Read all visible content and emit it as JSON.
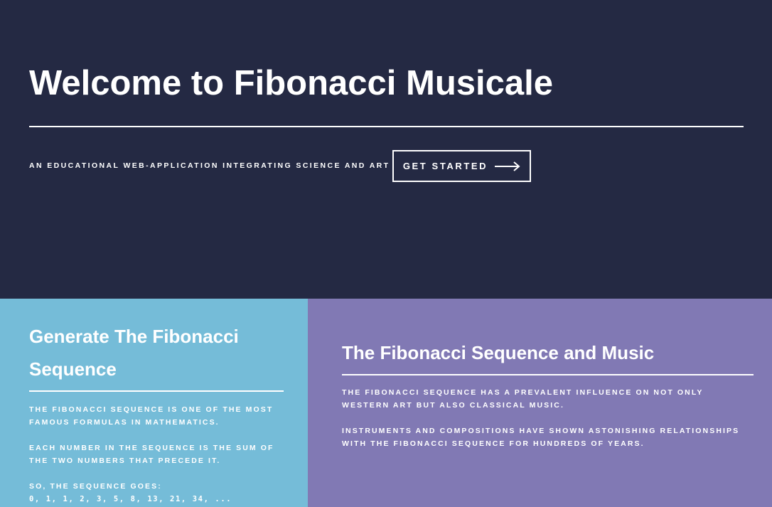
{
  "hero": {
    "title": "Welcome to Fibonacci Musicale",
    "subtitle": "AN EDUCATIONAL WEB-APPLICATION INTEGRATING SCIENCE AND ART",
    "cta_label": "GET STARTED"
  },
  "tiles": [
    {
      "title": "Generate The Fibonacci Sequence",
      "paragraphs": [
        "THE FIBONACCI SEQUENCE IS ONE OF THE MOST FAMOUS FORMULAS IN MATHEMATICS.",
        "EACH NUMBER IN THE SEQUENCE IS THE SUM OF THE TWO NUMBERS THAT PRECEDE IT.",
        "SO, THE SEQUENCE GOES:"
      ],
      "sequence": "0, 1, 1, 2, 3, 5, 8, 13, 21, 34, ..."
    },
    {
      "title": "The Fibonacci Sequence and Music",
      "paragraphs": [
        "THE FIBONACCI SEQUENCE HAS A PREVALENT INFLUENCE ON NOT ONLY WESTERN ART BUT ALSO CLASSICAL MUSIC.",
        "INSTRUMENTS AND COMPOSITIONS HAVE SHOWN ASTONISHING RELATIONSHIPS WITH THE FIBONACCI SEQUENCE FOR HUNDREDS OF YEARS."
      ]
    }
  ],
  "colors": {
    "hero_bg": "#242943",
    "tile_left_bg": "#75bcd8",
    "tile_right_bg": "#8179b4",
    "text": "#ffffff"
  },
  "icons": {
    "cta_arrow": "arrow-right-icon"
  }
}
